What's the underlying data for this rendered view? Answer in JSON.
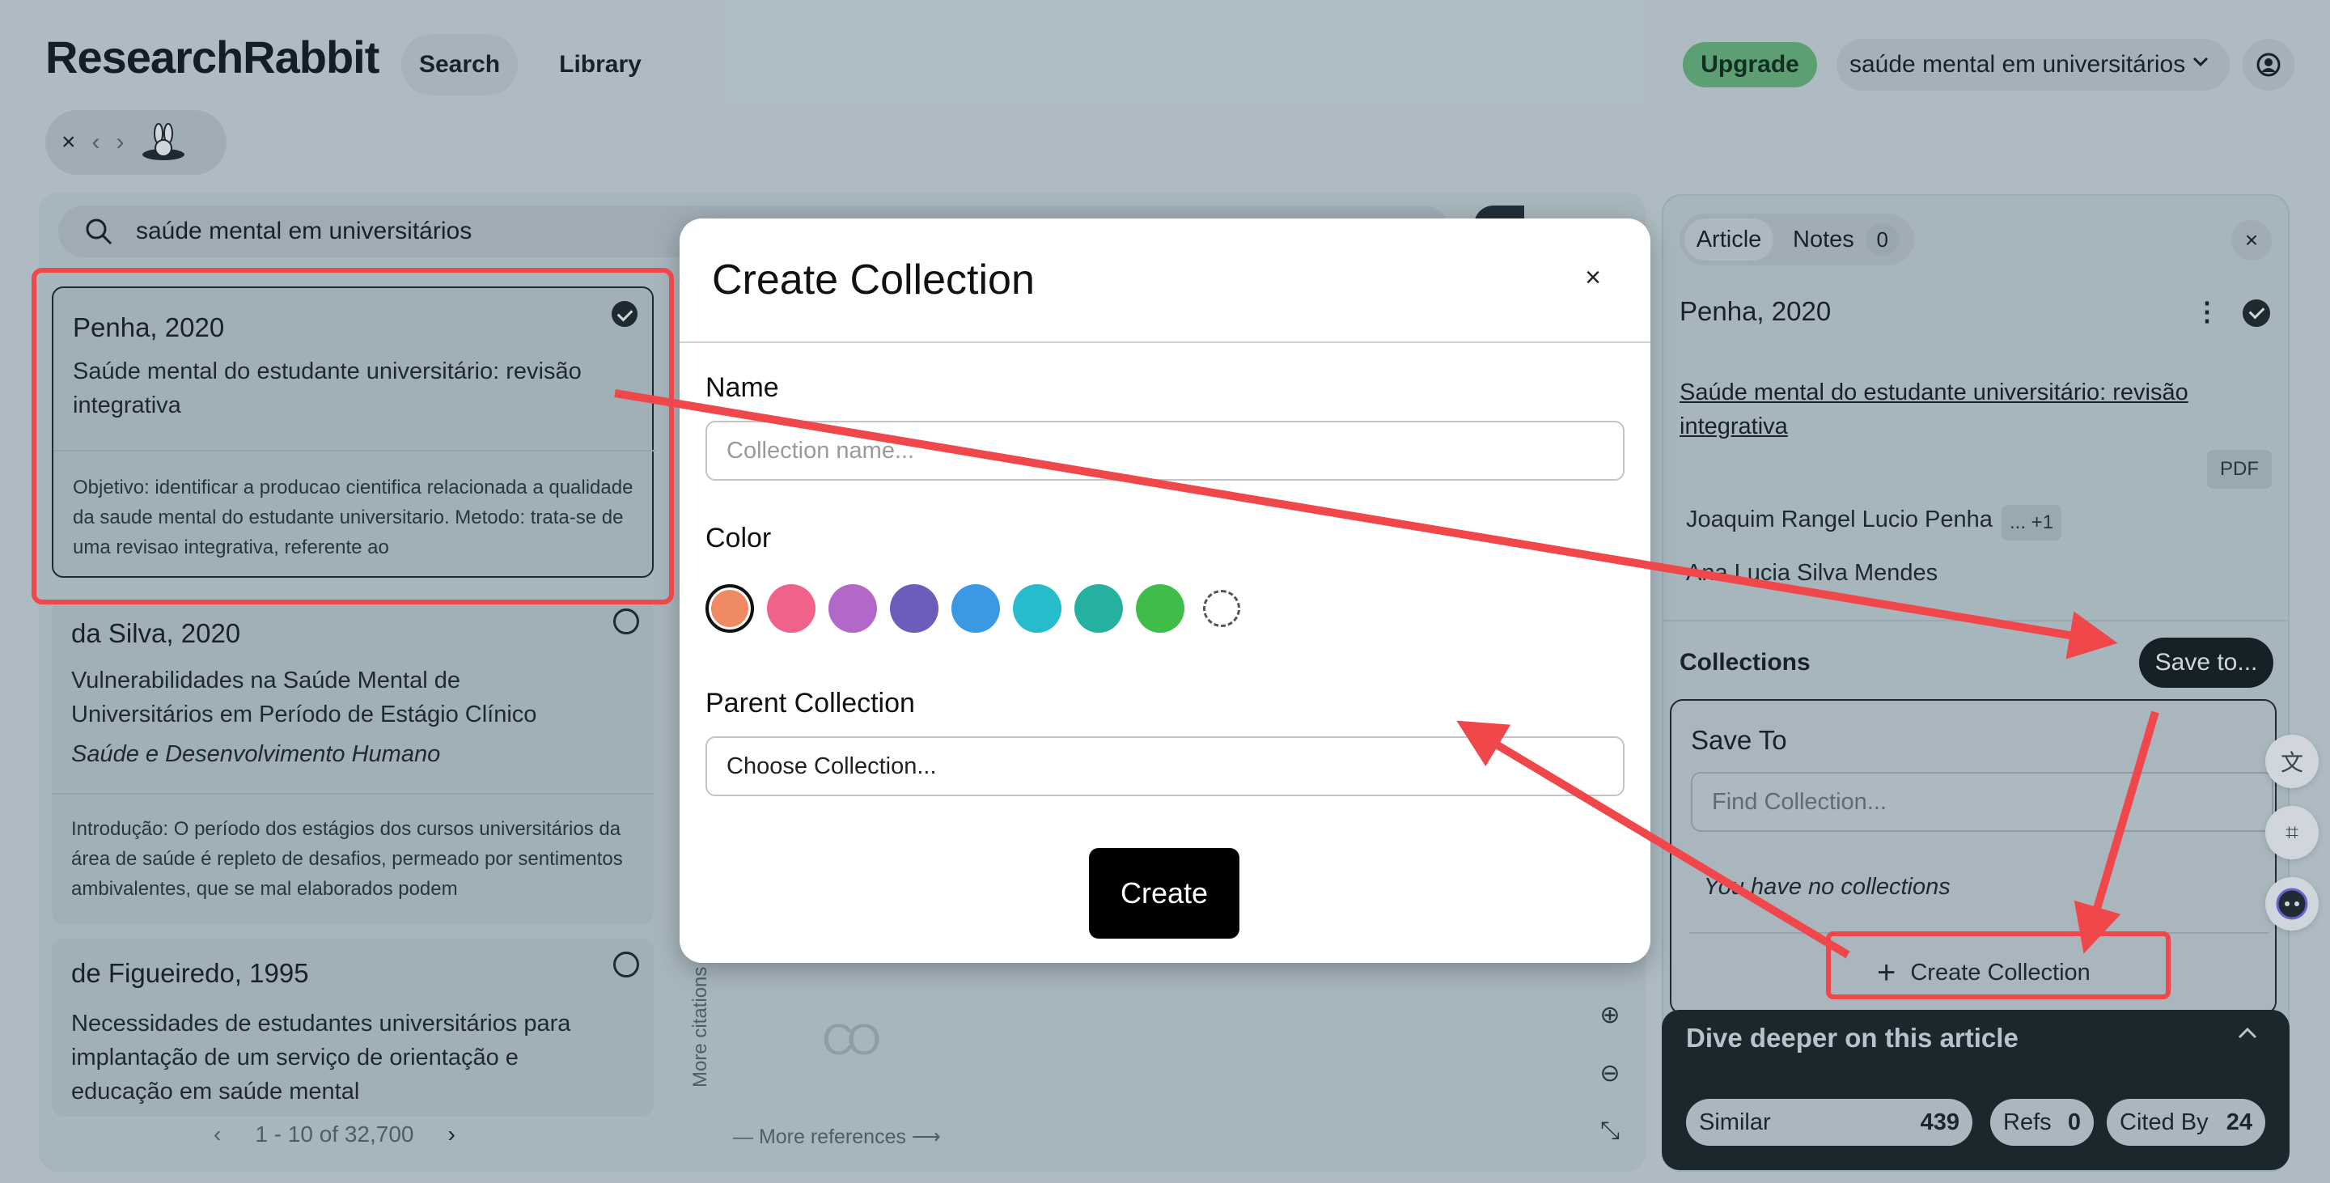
{
  "app": {
    "logo": "ResearchRabbit",
    "nav": {
      "search": "Search",
      "library": "Library"
    },
    "upgrade": "Upgrade",
    "topic": "saúde mental em universitários",
    "icons": {
      "close": "×",
      "back": "‹",
      "forward": "›",
      "chevron_down": "⌄",
      "search": "⌕"
    }
  },
  "search": {
    "query": "saúde mental em universitários"
  },
  "results": [
    {
      "author_year": "Penha, 2020",
      "title": "Saúde mental do estudante universitário: revisão integrativa",
      "journal": "",
      "abstract": "Objetivo: identificar a producao cientifica relacionada a qualidade da saude mental do estudante universitario. Metodo: trata-se de uma revisao integrativa, referente ao",
      "selected": true
    },
    {
      "author_year": "da Silva, 2020",
      "title": "Vulnerabilidades na Saúde Mental de Universitários em Período de Estágio Clínico",
      "journal": "Saúde e Desenvolvimento Humano",
      "abstract": "Introdução: O período dos estágios dos cursos universitários da área de saúde é repleto de desafios, permeado por sentimentos ambivalentes, que se mal elaborados podem",
      "selected": false
    },
    {
      "author_year": "de Figueiredo, 1995",
      "title": "Necessidades de estudantes universitários para implantação de um serviço de orientação e educação em saúde mental",
      "journal": "",
      "abstract": "",
      "selected": false
    }
  ],
  "pager": {
    "range": "1 - 10 of 32,700",
    "prev": "‹",
    "next": "›"
  },
  "graph": {
    "more_citations": "More citations",
    "more_references": "More references"
  },
  "article_panel": {
    "tabs": {
      "article": "Article",
      "notes": "Notes",
      "notes_count": "0"
    },
    "close": "×",
    "author_year": "Penha, 2020",
    "kebab": "⋮",
    "title": "Saúde mental do estudante universitário: revisão integrativa",
    "pdf": "PDF",
    "authors": [
      "Joaquim Rangel Lucio Penha",
      "Ana Lucia Silva Mendes"
    ],
    "more_authors": "... +1",
    "collections_label": "Collections",
    "save_to": "Save to..."
  },
  "save_to_popover": {
    "title": "Save To",
    "find_placeholder": "Find Collection...",
    "empty": "You have no collections",
    "create": "Create Collection",
    "plus": "+"
  },
  "dive_deeper": {
    "title": "Dive deeper on this article",
    "similar": {
      "label": "Similar",
      "count": "439"
    },
    "refs": {
      "label": "Refs",
      "count": "0"
    },
    "cited_by": {
      "label": "Cited By",
      "count": "24"
    }
  },
  "modal": {
    "title": "Create Collection",
    "close": "×",
    "name_label": "Name",
    "name_placeholder": "Collection name...",
    "color_label": "Color",
    "colors": [
      "#f08a62",
      "#f0628a",
      "#b268c8",
      "#6e5cba",
      "#3b98e4",
      "#26bccb",
      "#25b1a0",
      "#3fbd48"
    ],
    "selected_color": "#f08a62",
    "parent_label": "Parent Collection",
    "parent_value": "Choose Collection...",
    "create_button": "Create"
  },
  "annotation_color": "#f0474a"
}
